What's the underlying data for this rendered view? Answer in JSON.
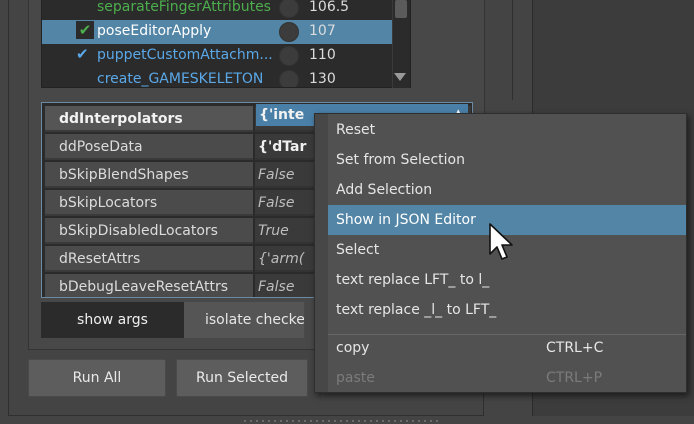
{
  "list": {
    "rows": [
      {
        "name": "separateFingerAttributes",
        "value": "106.5",
        "checked": false,
        "selected": false,
        "color": "#4cae4c"
      },
      {
        "name": "poseEditorApply",
        "value": "107",
        "checked": true,
        "selected": true,
        "color": "#ffffff"
      },
      {
        "name": "puppetCustomAttachm...",
        "value": "110",
        "checked": true,
        "selected": false,
        "color": "#5aa8e8"
      },
      {
        "name": "create_GAMESKELETON",
        "value": "130",
        "checked": false,
        "selected": false,
        "color": "#5aa8e8"
      }
    ],
    "check_glyph": "✔"
  },
  "attributes": {
    "rows": [
      {
        "name": "ddInterpolators",
        "value": "{'inte",
        "bold_value": true,
        "selected": true
      },
      {
        "name": "ddPoseData",
        "value": "{'dTar",
        "bold_value": true,
        "selected": false
      },
      {
        "name": "bSkipBlendShapes",
        "value": "False",
        "bold_value": false,
        "selected": false
      },
      {
        "name": "bSkipLocators",
        "value": "False",
        "bold_value": false,
        "selected": false
      },
      {
        "name": "bSkipDisabledLocators",
        "value": "True",
        "bold_value": false,
        "selected": false
      },
      {
        "name": "dResetAttrs",
        "value": "{'arm(",
        "bold_value": false,
        "selected": false
      },
      {
        "name": "bDebugLeaveResetAttrs",
        "value": "False",
        "bold_value": false,
        "selected": false
      }
    ]
  },
  "tabs": {
    "show_args": "show args",
    "isolate": "isolate checked"
  },
  "buttons": {
    "run_all": "Run All",
    "run_selected": "Run Selected"
  },
  "context_menu": {
    "items": [
      {
        "label": "Reset",
        "shortcut": "",
        "highlight": false,
        "disabled": false
      },
      {
        "label": "Set from Selection",
        "shortcut": "",
        "highlight": false,
        "disabled": false
      },
      {
        "label": "Add Selection",
        "shortcut": "",
        "highlight": false,
        "disabled": false
      },
      {
        "label": "Show in JSON Editor",
        "shortcut": "",
        "highlight": true,
        "disabled": false
      },
      {
        "label": "Select",
        "shortcut": "",
        "highlight": false,
        "disabled": false
      },
      {
        "label": "text replace LFT_ to l_",
        "shortcut": "",
        "highlight": false,
        "disabled": false
      },
      {
        "label": "text replace _l_ to LFT_",
        "shortcut": "",
        "highlight": false,
        "disabled": false
      },
      {
        "label": "copy",
        "shortcut": "CTRL+C",
        "highlight": false,
        "disabled": false
      },
      {
        "label": "paste",
        "shortcut": "CTRL+P",
        "highlight": false,
        "disabled": true
      }
    ]
  },
  "colors": {
    "accent": "#5285a6",
    "background": "#444444",
    "menu_bg": "#515151",
    "list_green": "#4cae4c",
    "list_blue": "#5aa8e8"
  }
}
